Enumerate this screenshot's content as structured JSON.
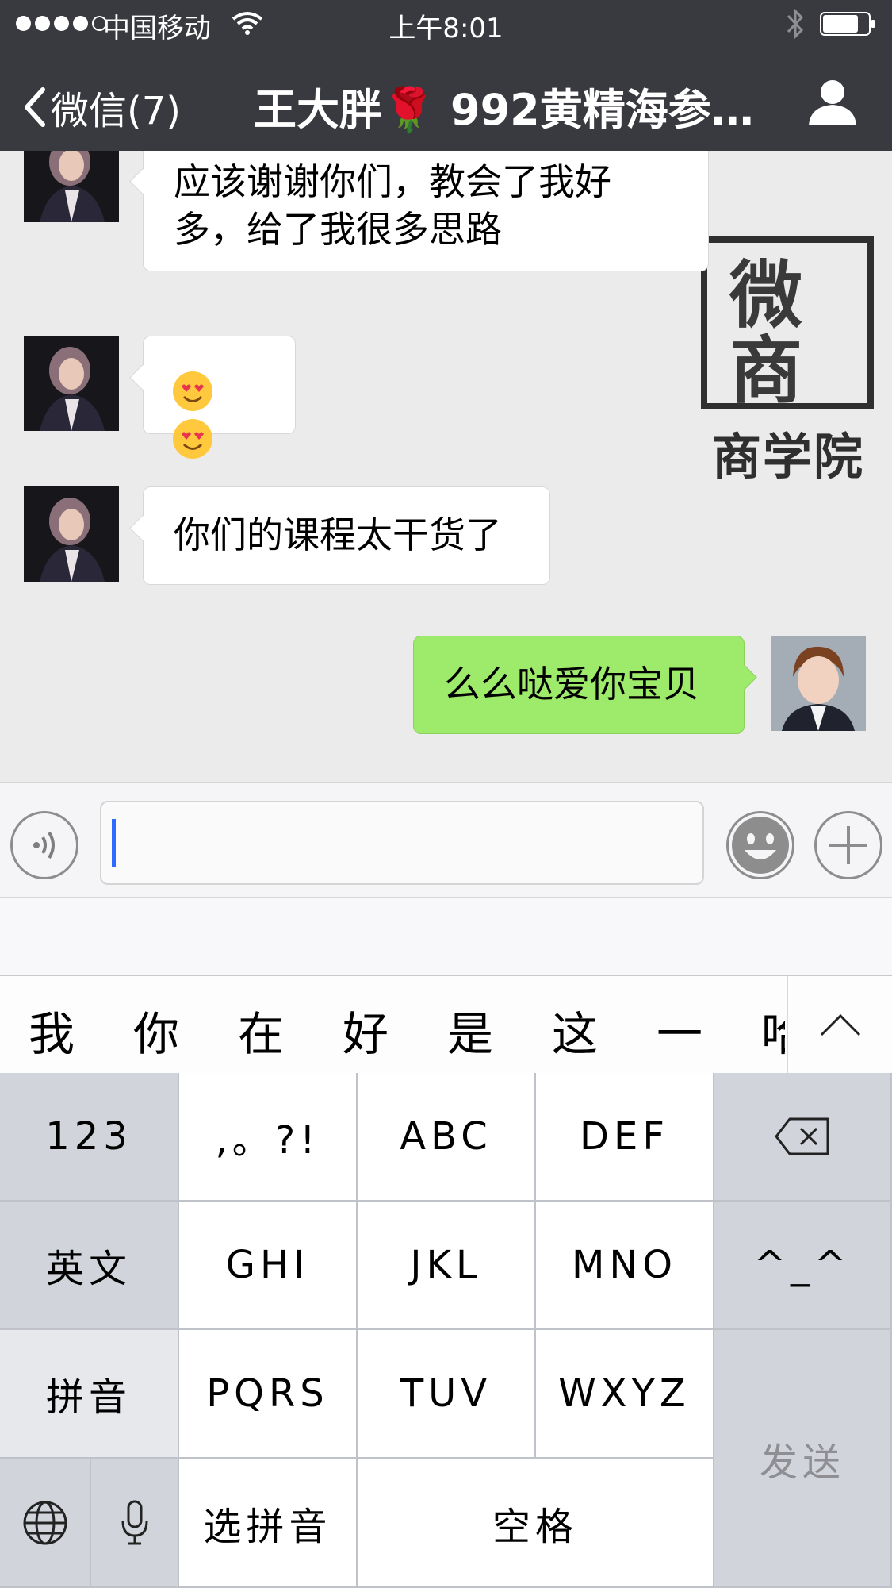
{
  "status_bar": {
    "carrier": "中国移动",
    "time": "上午8:01"
  },
  "nav": {
    "back_label": "微信(7)",
    "title": "王大胖🌹  992黄精海参…"
  },
  "messages": [
    {
      "direction": "incoming",
      "text_line1": "应该谢谢你们，教会了我好",
      "text_line2": "多，给了我很多思路"
    },
    {
      "direction": "incoming",
      "emoji": [
        "smiling-face-with-heart-eyes",
        "smiling-face-with-heart-eyes"
      ]
    },
    {
      "direction": "incoming",
      "text": "你们的课程太干货了"
    },
    {
      "direction": "outgoing",
      "text": "么么哒爱你宝贝"
    }
  ],
  "watermark": {
    "logo_chars": [
      "微",
      "商"
    ],
    "caption": "商学院"
  },
  "input": {
    "value": "",
    "placeholder": ""
  },
  "candidates": [
    "我",
    "你",
    "在",
    "好",
    "是",
    "这",
    "一",
    "哈"
  ],
  "keyboard": {
    "row1": [
      "123",
      ",。?!",
      "ABC",
      "DEF"
    ],
    "row2": [
      "英文",
      "GHI",
      "JKL",
      "MNO",
      "^_^"
    ],
    "row3": [
      "拼音",
      "PQRS",
      "TUV",
      "WXYZ"
    ],
    "row4": [
      "选拼音",
      "空格"
    ],
    "send": "发送"
  },
  "colors": {
    "nav_bg": "#393a3f",
    "outgoing_bubble": "#9eea6a",
    "caret": "#2f6bff"
  }
}
